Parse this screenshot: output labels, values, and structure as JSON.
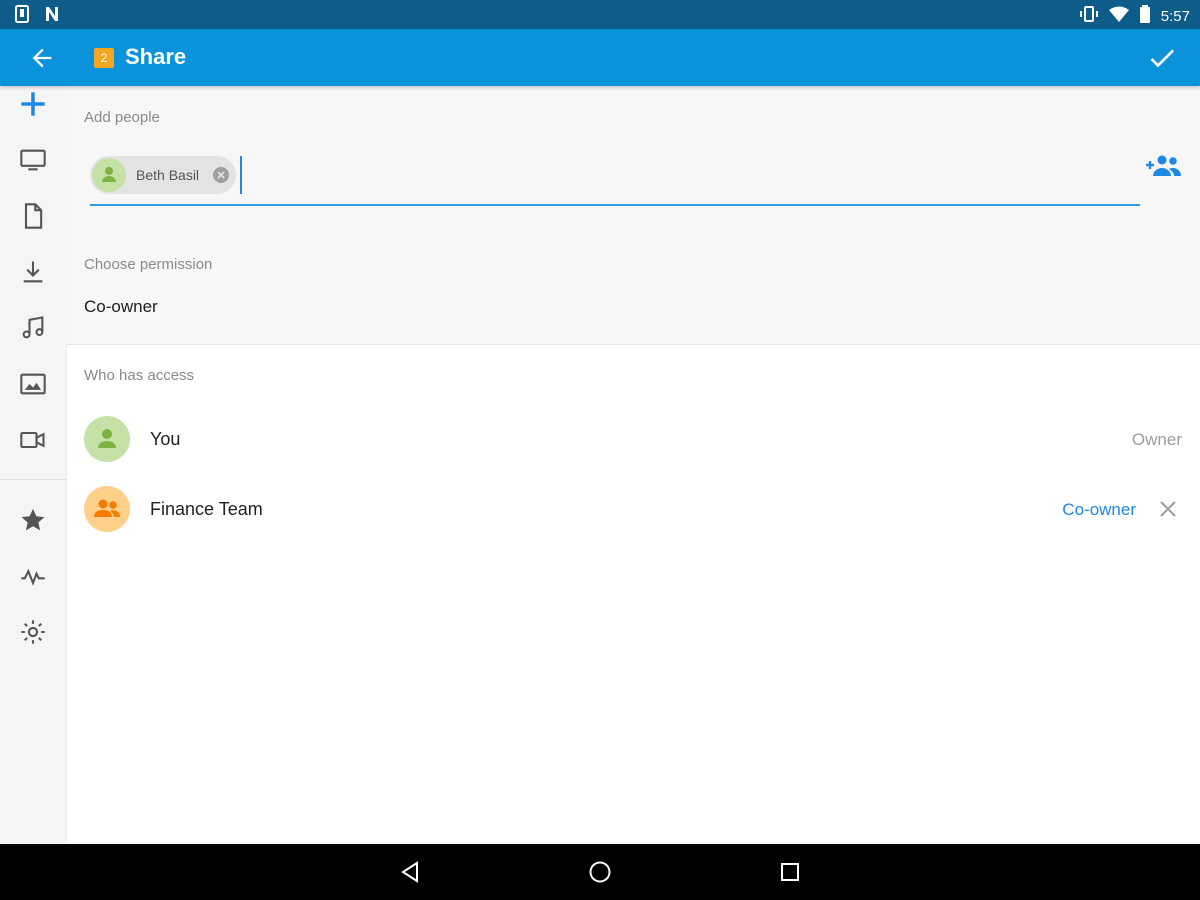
{
  "status_bar": {
    "left_icons": [
      "tablet-icon",
      "n-notification-icon"
    ],
    "right_icons": [
      "vibrate-icon",
      "wifi-icon",
      "battery-icon"
    ],
    "time": "5:57"
  },
  "app_bar": {
    "badge_count": "2",
    "title": "Share",
    "back_icon": "arrow-left-icon",
    "confirm_icon": "check-icon"
  },
  "nav_rail": {
    "items": [
      "add-icon",
      "monitor-icon",
      "document-icon",
      "download-icon",
      "music-icon",
      "image-icon",
      "video-icon",
      "star-icon",
      "activity-icon",
      "settings-icon"
    ]
  },
  "add_people": {
    "label": "Add people",
    "chips": [
      {
        "name": "Beth Basil"
      }
    ],
    "input_value": "",
    "add_icon": "add-people-icon"
  },
  "permission": {
    "label": "Choose permission",
    "value": "Co-owner"
  },
  "access": {
    "label": "Who has access",
    "members": [
      {
        "name": "You",
        "role": "Owner",
        "role_color": "#9e9e9e",
        "avatar_color": "#c5e1a5",
        "icon_color": "#7cb342",
        "removable": false
      },
      {
        "name": "Finance Team",
        "role": "Co-owner",
        "role_color": "#1e88e5",
        "avatar_color": "#ffd08a",
        "icon_color": "#f57c00",
        "removable": true
      }
    ]
  },
  "colors": {
    "status_bar": "#0d5c8a",
    "app_bar": "#0a93da",
    "accent": "#1e88e5",
    "badge": "#f5a623"
  },
  "system_nav": [
    "back-triangle-icon",
    "home-circle-icon",
    "recents-square-icon"
  ]
}
